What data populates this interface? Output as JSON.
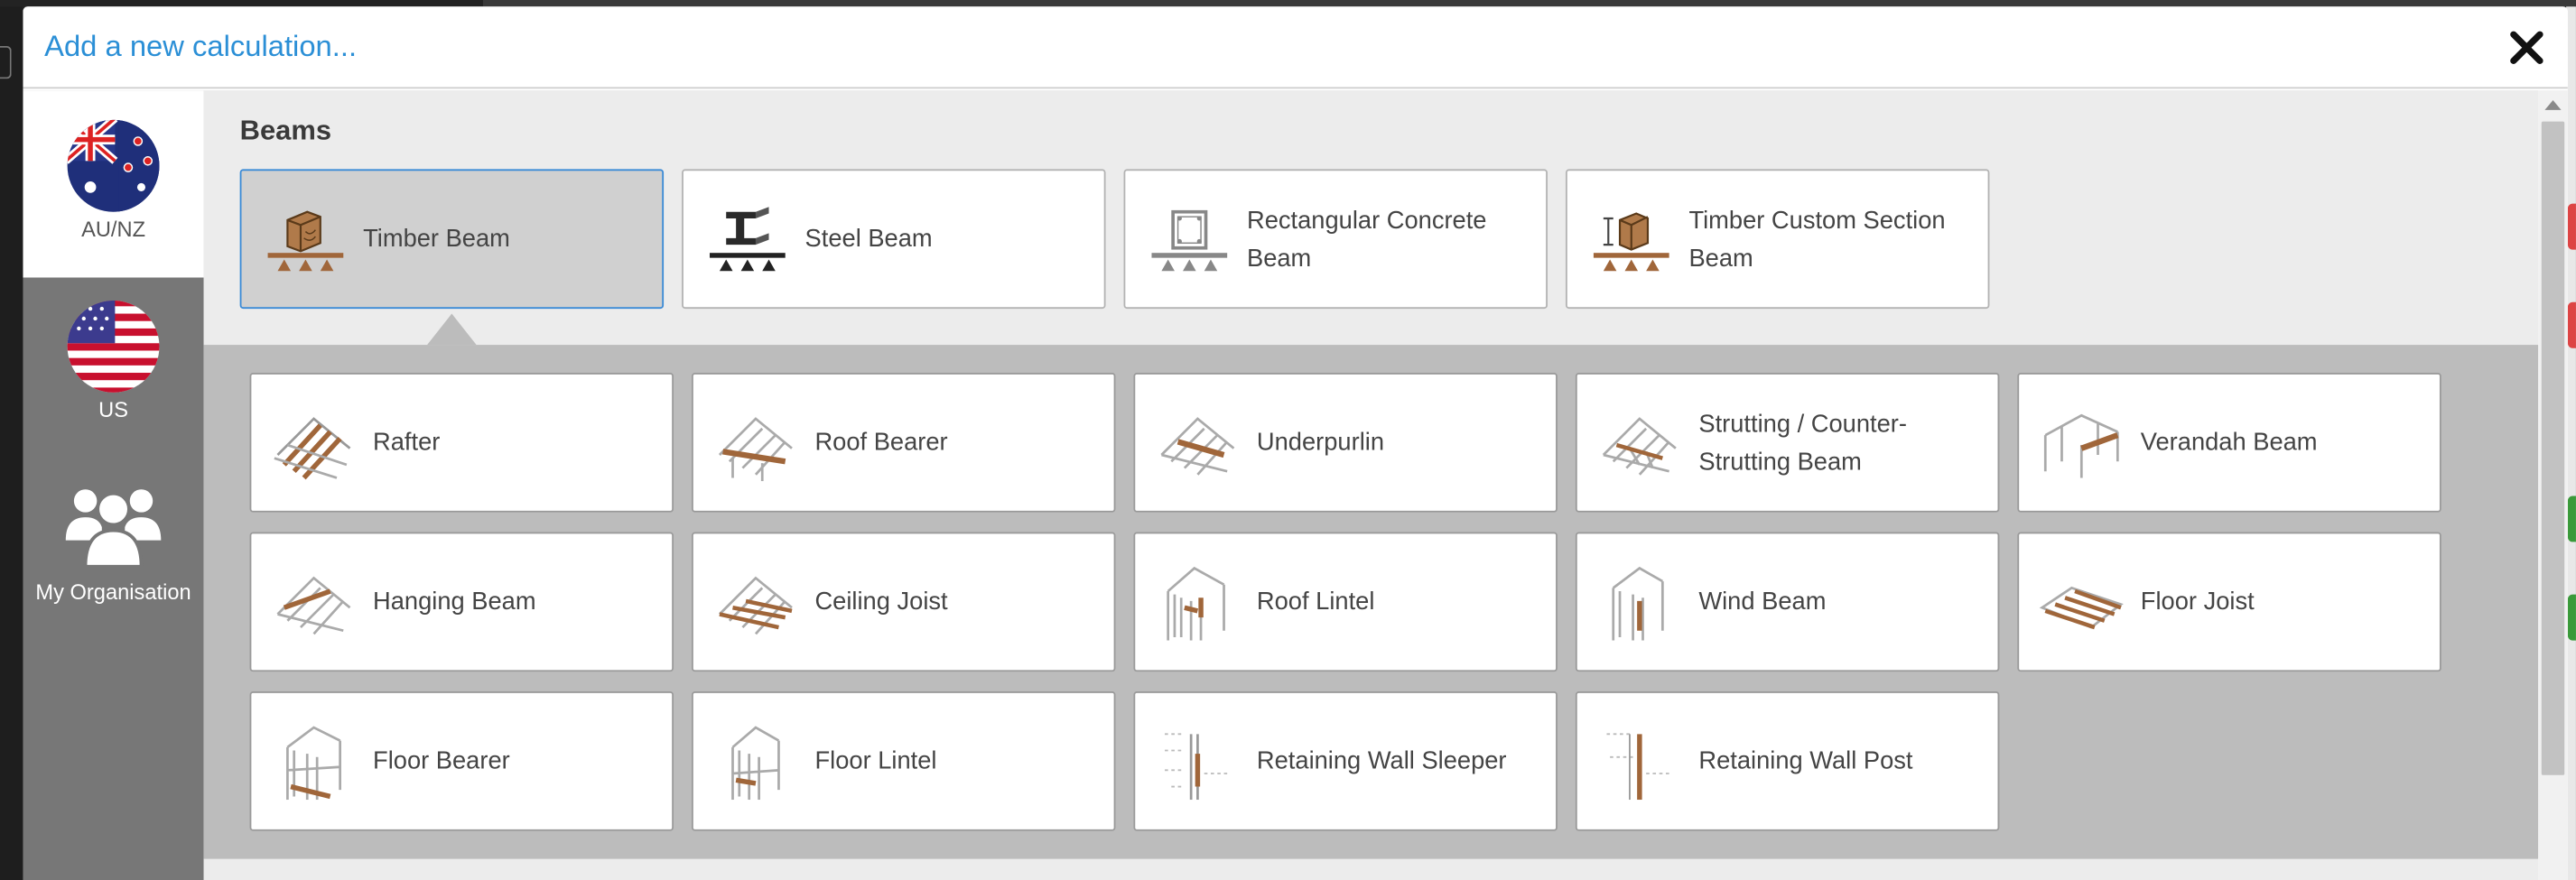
{
  "modal": {
    "title": "Add a new calculation..."
  },
  "sidebar": {
    "items": [
      {
        "label": "AU/NZ",
        "icon": "au-nz-flag-icon",
        "active": true
      },
      {
        "label": "US",
        "icon": "us-flag-icon",
        "active": false
      },
      {
        "label": "My Organisation",
        "icon": "users-group-icon",
        "active": false
      }
    ]
  },
  "section": {
    "title": "Beams"
  },
  "beam_types": [
    {
      "label": "Timber Beam",
      "icon": "timber-beam-icon",
      "selected": true
    },
    {
      "label": "Steel Beam",
      "icon": "steel-beam-icon",
      "selected": false
    },
    {
      "label": "Rectangular Concrete Beam",
      "icon": "concrete-beam-icon",
      "selected": false
    },
    {
      "label": "Timber Custom Section Beam",
      "icon": "timber-custom-section-icon",
      "selected": false
    }
  ],
  "timber_beam_options": [
    {
      "label": "Rafter",
      "icon": "rafter-icon"
    },
    {
      "label": "Roof Bearer",
      "icon": "roof-bearer-icon"
    },
    {
      "label": "Underpurlin",
      "icon": "underpurlin-icon"
    },
    {
      "label": "Strutting / Counter-Strutting Beam",
      "icon": "strutting-beam-icon"
    },
    {
      "label": "Verandah Beam",
      "icon": "verandah-beam-icon"
    },
    {
      "label": "Hanging Beam",
      "icon": "hanging-beam-icon"
    },
    {
      "label": "Ceiling Joist",
      "icon": "ceiling-joist-icon"
    },
    {
      "label": "Roof Lintel",
      "icon": "roof-lintel-icon"
    },
    {
      "label": "Wind Beam",
      "icon": "wind-beam-icon"
    },
    {
      "label": "Floor Joist",
      "icon": "floor-joist-icon"
    },
    {
      "label": "Floor Bearer",
      "icon": "floor-bearer-icon"
    },
    {
      "label": "Floor Lintel",
      "icon": "floor-lintel-icon"
    },
    {
      "label": "Retaining Wall Sleeper",
      "icon": "retaining-wall-sleeper-icon"
    },
    {
      "label": "Retaining Wall Post",
      "icon": "retaining-wall-post-icon"
    }
  ],
  "colors": {
    "accent": "#2b8fd6",
    "timber": "#a0663a",
    "sidebar": "#777777"
  }
}
